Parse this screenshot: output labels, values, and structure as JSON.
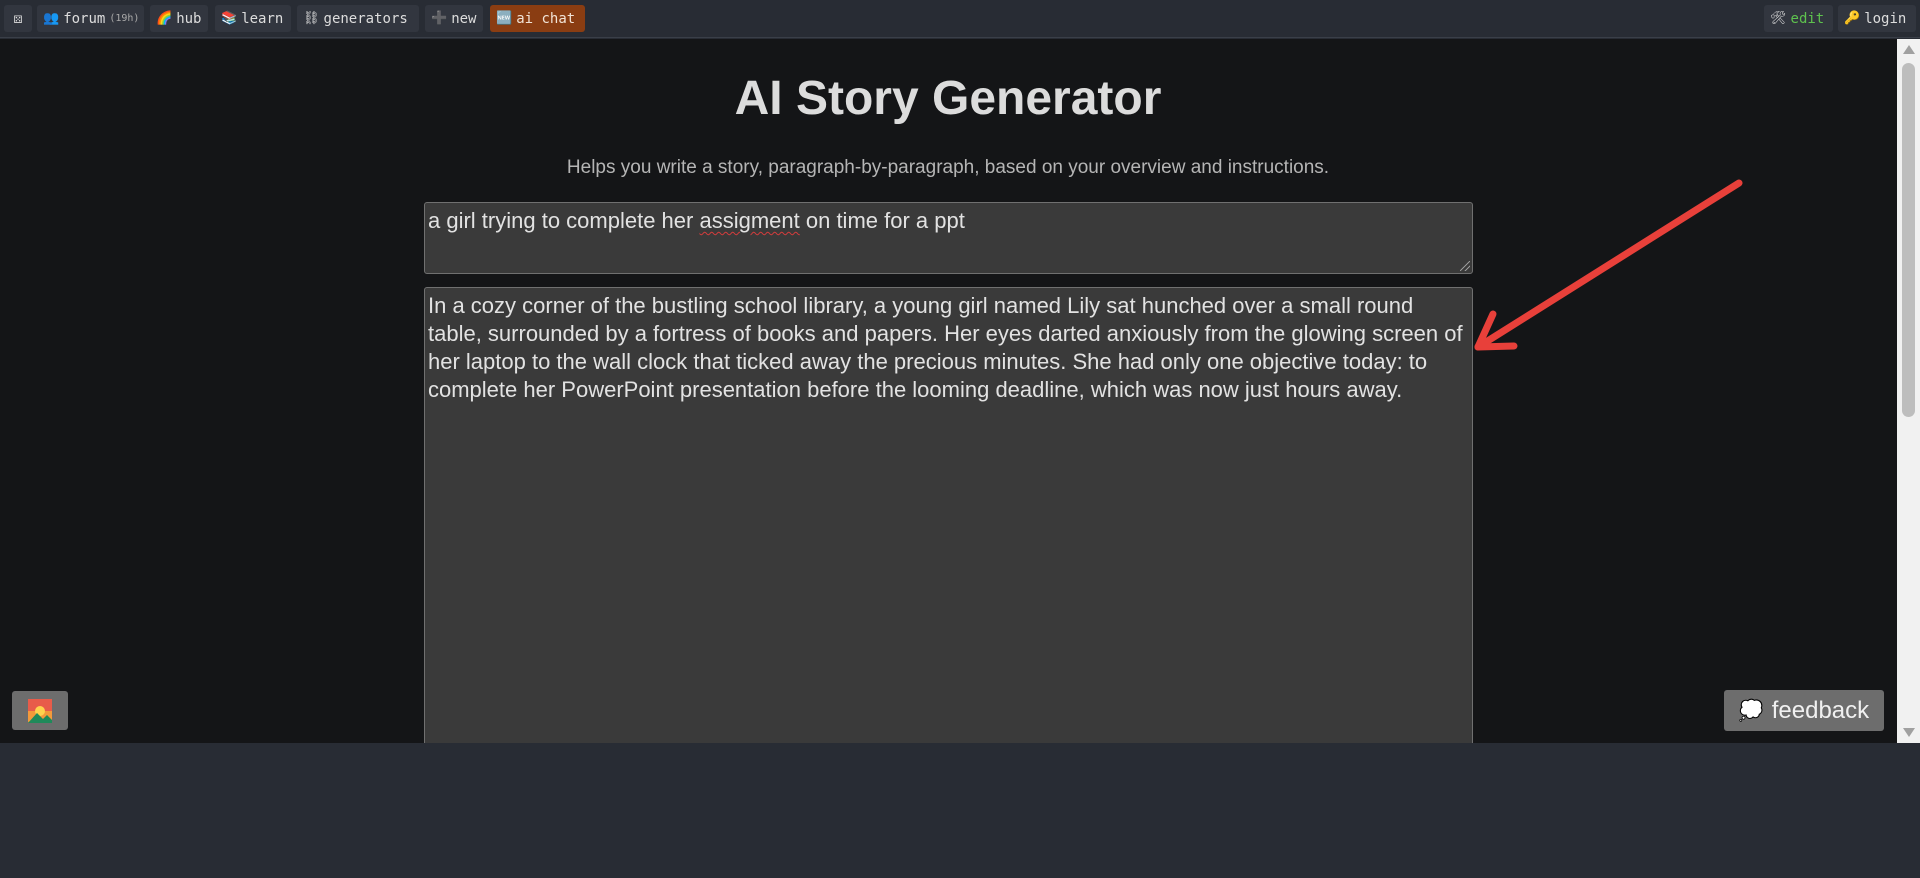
{
  "nav": {
    "home_icon": "⚄",
    "left_items": [
      {
        "label": "forum",
        "sub": "(19h)",
        "icon": "👥"
      },
      {
        "label": "hub",
        "icon": "🌈"
      },
      {
        "label": "learn",
        "icon": "📚"
      },
      {
        "label": "generators",
        "icon": "⛓"
      },
      {
        "label": "new",
        "icon": "➕"
      },
      {
        "label": "ai chat",
        "icon": "🆕"
      }
    ],
    "right_items": [
      {
        "label": "edit",
        "icon": "🛠"
      },
      {
        "label": "login",
        "icon": "🔑"
      }
    ]
  },
  "page": {
    "title": "AI Story Generator",
    "subtitle": "Helps you write a story, paragraph-by-paragraph, based on your overview and instructions.",
    "overview_pre": "a girl trying to complete her ",
    "overview_misspelled": "assigment",
    "overview_post": " on time for a ppt",
    "story_text": "In a cozy corner of the bustling school library, a young girl named Lily sat hunched over a small round table, surrounded by a fortress of books and papers. Her eyes darted anxiously from the glowing screen of her laptop to the wall clock that ticked away the precious minutes. She had only one objective today: to complete her PowerPoint presentation before the looming deadline, which was now just hours away."
  },
  "feedback": {
    "label": "feedback",
    "icon": "💭"
  },
  "colors": {
    "arrow": "#e8403a",
    "ai_chat_bg": "#8a3d12",
    "edit_text": "#5ec24e"
  }
}
